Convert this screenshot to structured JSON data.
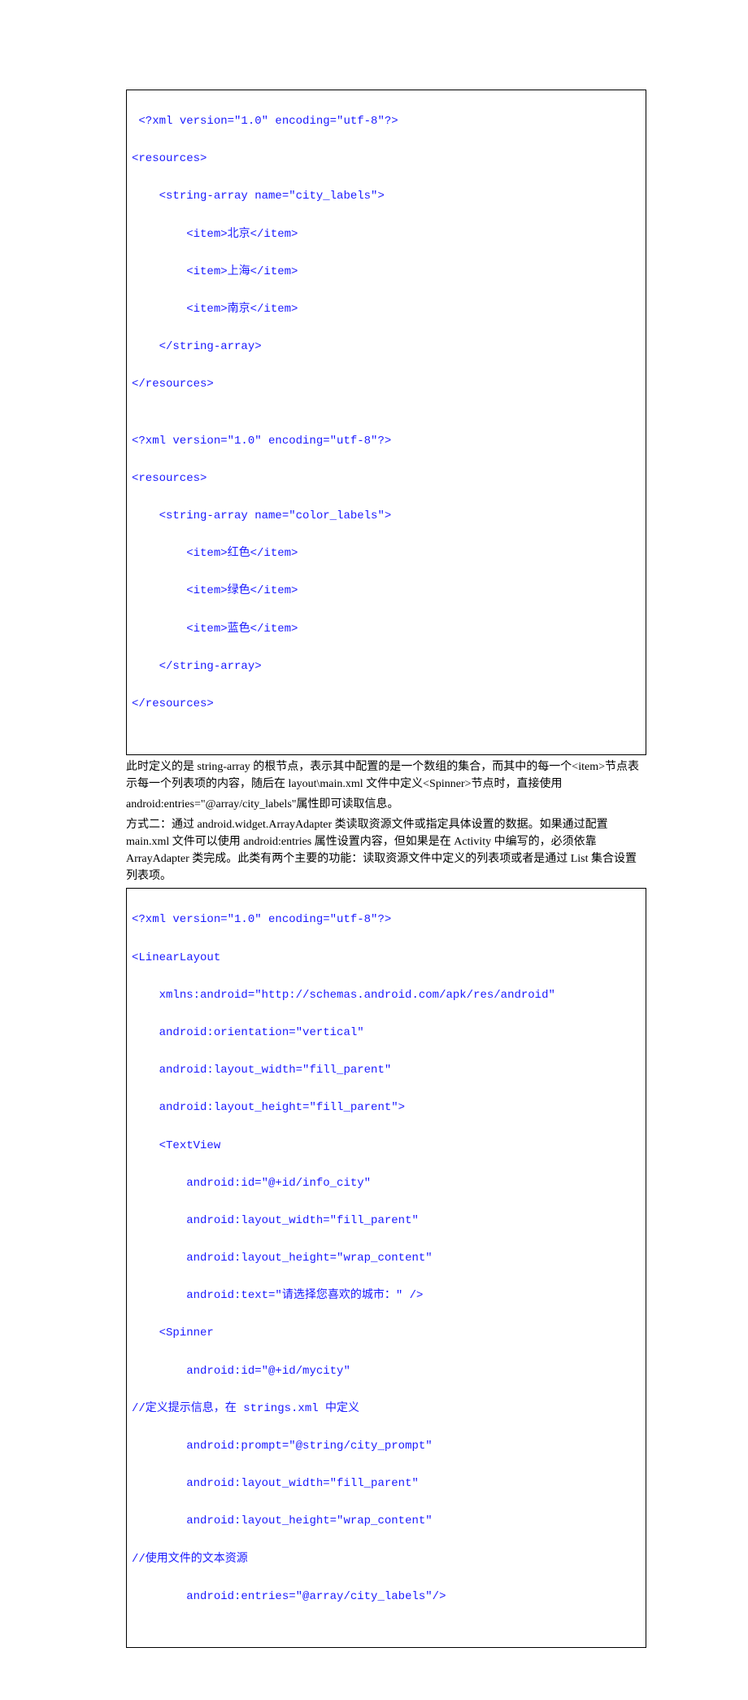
{
  "codebox1": {
    "l1": " <?xml version=\"1.0\" encoding=\"utf-8\"?>",
    "l2": "<resources>",
    "l3": "    <string-array name=\"city_labels\">",
    "l4": "        <item>北京</item>",
    "l5": "        <item>上海</item>",
    "l6": "        <item>南京</item>",
    "l7": "    </string-array>",
    "l8": "</resources>",
    "l9": "",
    "l10": "<?xml version=\"1.0\" encoding=\"utf-8\"?>",
    "l11": "<resources>",
    "l12": "    <string-array name=\"color_labels\">",
    "l13": "        <item>红色</item>",
    "l14": "        <item>绿色</item>",
    "l15": "        <item>蓝色</item>",
    "l16": "    </string-array>",
    "l17": "</resources>"
  },
  "prose1": {
    "p1": "此时定义的是 string-array 的根节点，表示其中配置的是一个数组的集合，而其中的每一个<item>节点表示每一个列表项的内容，随后在 layout\\main.xml 文件中定义<Spinner>节点时，直接使用",
    "p2": "android:entries=\"@array/city_labels\"属性即可读取信息。",
    "p3": "方式二：通过 android.widget.ArrayAdapter 类读取资源文件或指定具体设置的数据。如果通过配置 main.xml 文件可以使用 android:entries 属性设置内容，但如果是在 Activity 中编写的，必须依靠 ArrayAdapter 类完成。此类有两个主要的功能：读取资源文件中定义的列表项或者是通过 List 集合设置列表项。"
  },
  "codebox2": {
    "l1": "<?xml version=\"1.0\" encoding=\"utf-8\"?>",
    "l2": "<LinearLayout",
    "l3": "    xmlns:android=\"http://schemas.android.com/apk/res/android\"",
    "l4": "    android:orientation=\"vertical\"",
    "l5": "    android:layout_width=\"fill_parent\"",
    "l6": "    android:layout_height=\"fill_parent\">",
    "l7": "    <TextView",
    "l8": "        android:id=\"@+id/info_city\"",
    "l9": "        android:layout_width=\"fill_parent\"",
    "l10": "        android:layout_height=\"wrap_content\"",
    "l11": "        android:text=\"请选择您喜欢的城市：\" />",
    "l12": "    <Spinner",
    "l13": "        android:id=\"@+id/mycity\"",
    "l14": "//定义提示信息，在 strings.xml 中定义",
    "l15": "        android:prompt=\"@string/city_prompt\"",
    "l16": "        android:layout_width=\"fill_parent\"",
    "l17": "        android:layout_height=\"wrap_content\"",
    "l18": "//使用文件的文本资源",
    "l19": "        android:entries=\"@array/city_labels\"/>"
  }
}
